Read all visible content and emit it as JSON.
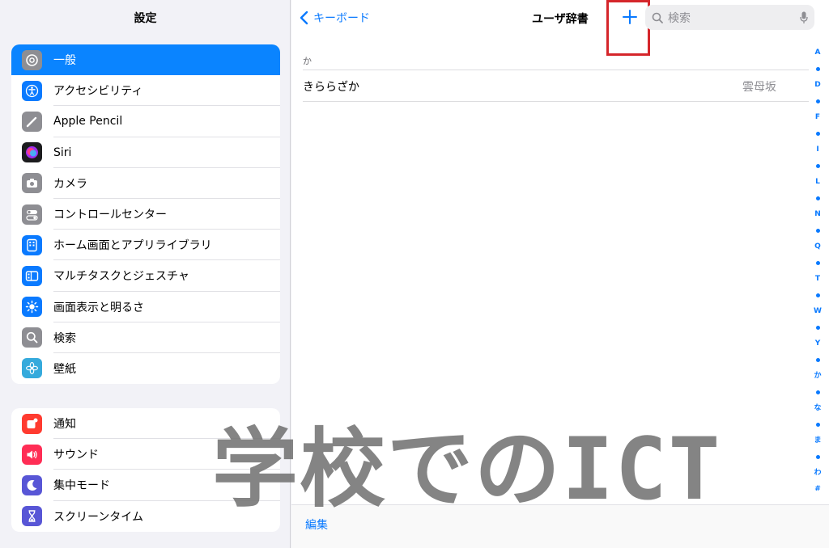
{
  "sidebar": {
    "title": "設定",
    "group1": [
      {
        "label": "一般",
        "icon": "gear-icon",
        "color": "#8e8e93",
        "selected": true
      },
      {
        "label": "アクセシビリティ",
        "icon": "accessibility-icon",
        "color": "#0a7aff"
      },
      {
        "label": "Apple Pencil",
        "icon": "pencil-icon",
        "color": "#8e8e93"
      },
      {
        "label": "Siri",
        "icon": "siri-icon",
        "color": "#1c1c1e"
      },
      {
        "label": "カメラ",
        "icon": "camera-icon",
        "color": "#8e8e93"
      },
      {
        "label": "コントロールセンター",
        "icon": "toggles-icon",
        "color": "#8e8e93"
      },
      {
        "label": "ホーム画面とアプリライブラリ",
        "icon": "home-screen-icon",
        "color": "#0a7aff"
      },
      {
        "label": "マルチタスクとジェスチャ",
        "icon": "multitask-icon",
        "color": "#0a7aff"
      },
      {
        "label": "画面表示と明るさ",
        "icon": "brightness-icon",
        "color": "#0a7aff"
      },
      {
        "label": "検索",
        "icon": "search-icon",
        "color": "#8e8e93"
      },
      {
        "label": "壁紙",
        "icon": "wallpaper-icon",
        "color": "#35aadc"
      }
    ],
    "group2": [
      {
        "label": "通知",
        "icon": "notification-icon",
        "color": "#ff3b30"
      },
      {
        "label": "サウンド",
        "icon": "sound-icon",
        "color": "#ff2d55"
      },
      {
        "label": "集中モード",
        "icon": "moon-icon",
        "color": "#5856d6"
      },
      {
        "label": "スクリーンタイム",
        "icon": "hourglass-icon",
        "color": "#5856d6"
      }
    ]
  },
  "main": {
    "back_label": "キーボード",
    "title": "ユーザ辞書",
    "search_placeholder": "検索",
    "section_header": "か",
    "entry": {
      "word": "きららざか",
      "reading": "雲母坂"
    },
    "index": [
      "A",
      "•",
      "D",
      "•",
      "F",
      "•",
      "I",
      "•",
      "L",
      "•",
      "N",
      "•",
      "Q",
      "•",
      "T",
      "•",
      "W",
      "•",
      "Y",
      "•",
      "か",
      "•",
      "な",
      "•",
      "ま",
      "•",
      "わ",
      "#"
    ],
    "edit_label": "編集"
  },
  "watermark": "学校でのICT",
  "colors": {
    "accent": "#0a7aff",
    "highlight": "#d5262b"
  }
}
